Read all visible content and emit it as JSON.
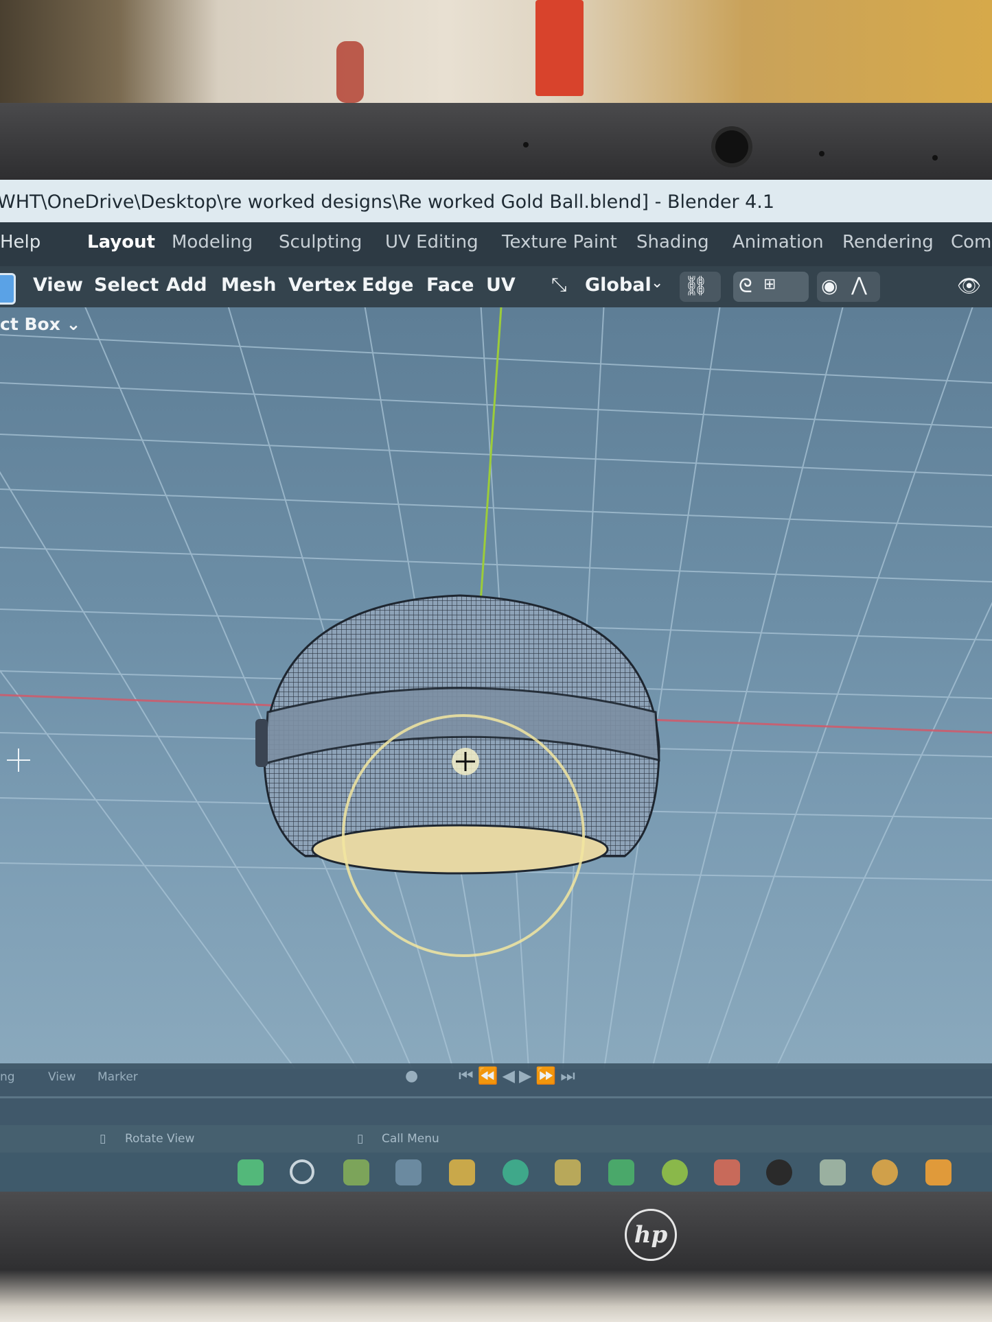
{
  "window": {
    "title": "WHT\\OneDrive\\Desktop\\re worked designs\\Re worked Gold Ball.blend] - Blender 4.1"
  },
  "menubar": {
    "help": "Help",
    "workspaces": [
      {
        "label": "Layout",
        "active": true
      },
      {
        "label": "Modeling",
        "active": false
      },
      {
        "label": "Sculpting",
        "active": false
      },
      {
        "label": "UV Editing",
        "active": false
      },
      {
        "label": "Texture Paint",
        "active": false
      },
      {
        "label": "Shading",
        "active": false
      },
      {
        "label": "Animation",
        "active": false
      },
      {
        "label": "Rendering",
        "active": false
      },
      {
        "label": "Comp",
        "active": false
      }
    ]
  },
  "header": {
    "menus": [
      "View",
      "Select",
      "Add",
      "Mesh",
      "Vertex",
      "Edge",
      "Face",
      "UV"
    ],
    "transform_orientation": "Global",
    "icons": [
      "editor-type-icon",
      "orientation-icon",
      "pivot-link-icon",
      "snap-magnet-icon",
      "snap-increment-icon",
      "proportional-edit-icon",
      "falloff-curve-icon",
      "visibility-eye-icon"
    ]
  },
  "tool_options": {
    "select_mode": "ct Box"
  },
  "timeline": {
    "mode": "ng",
    "view": "View",
    "marker": "Marker"
  },
  "statusbar": {
    "rotate_view": "Rotate View",
    "call_menu": "Call Menu"
  },
  "colors": {
    "viewport": "#6c8ea6",
    "grid": "#a9c4d6",
    "x_axis": "#d25a6a",
    "y_axis": "#9ccc3a",
    "mesh_wire": "#2a3340",
    "selection": "#f2e6a0"
  }
}
